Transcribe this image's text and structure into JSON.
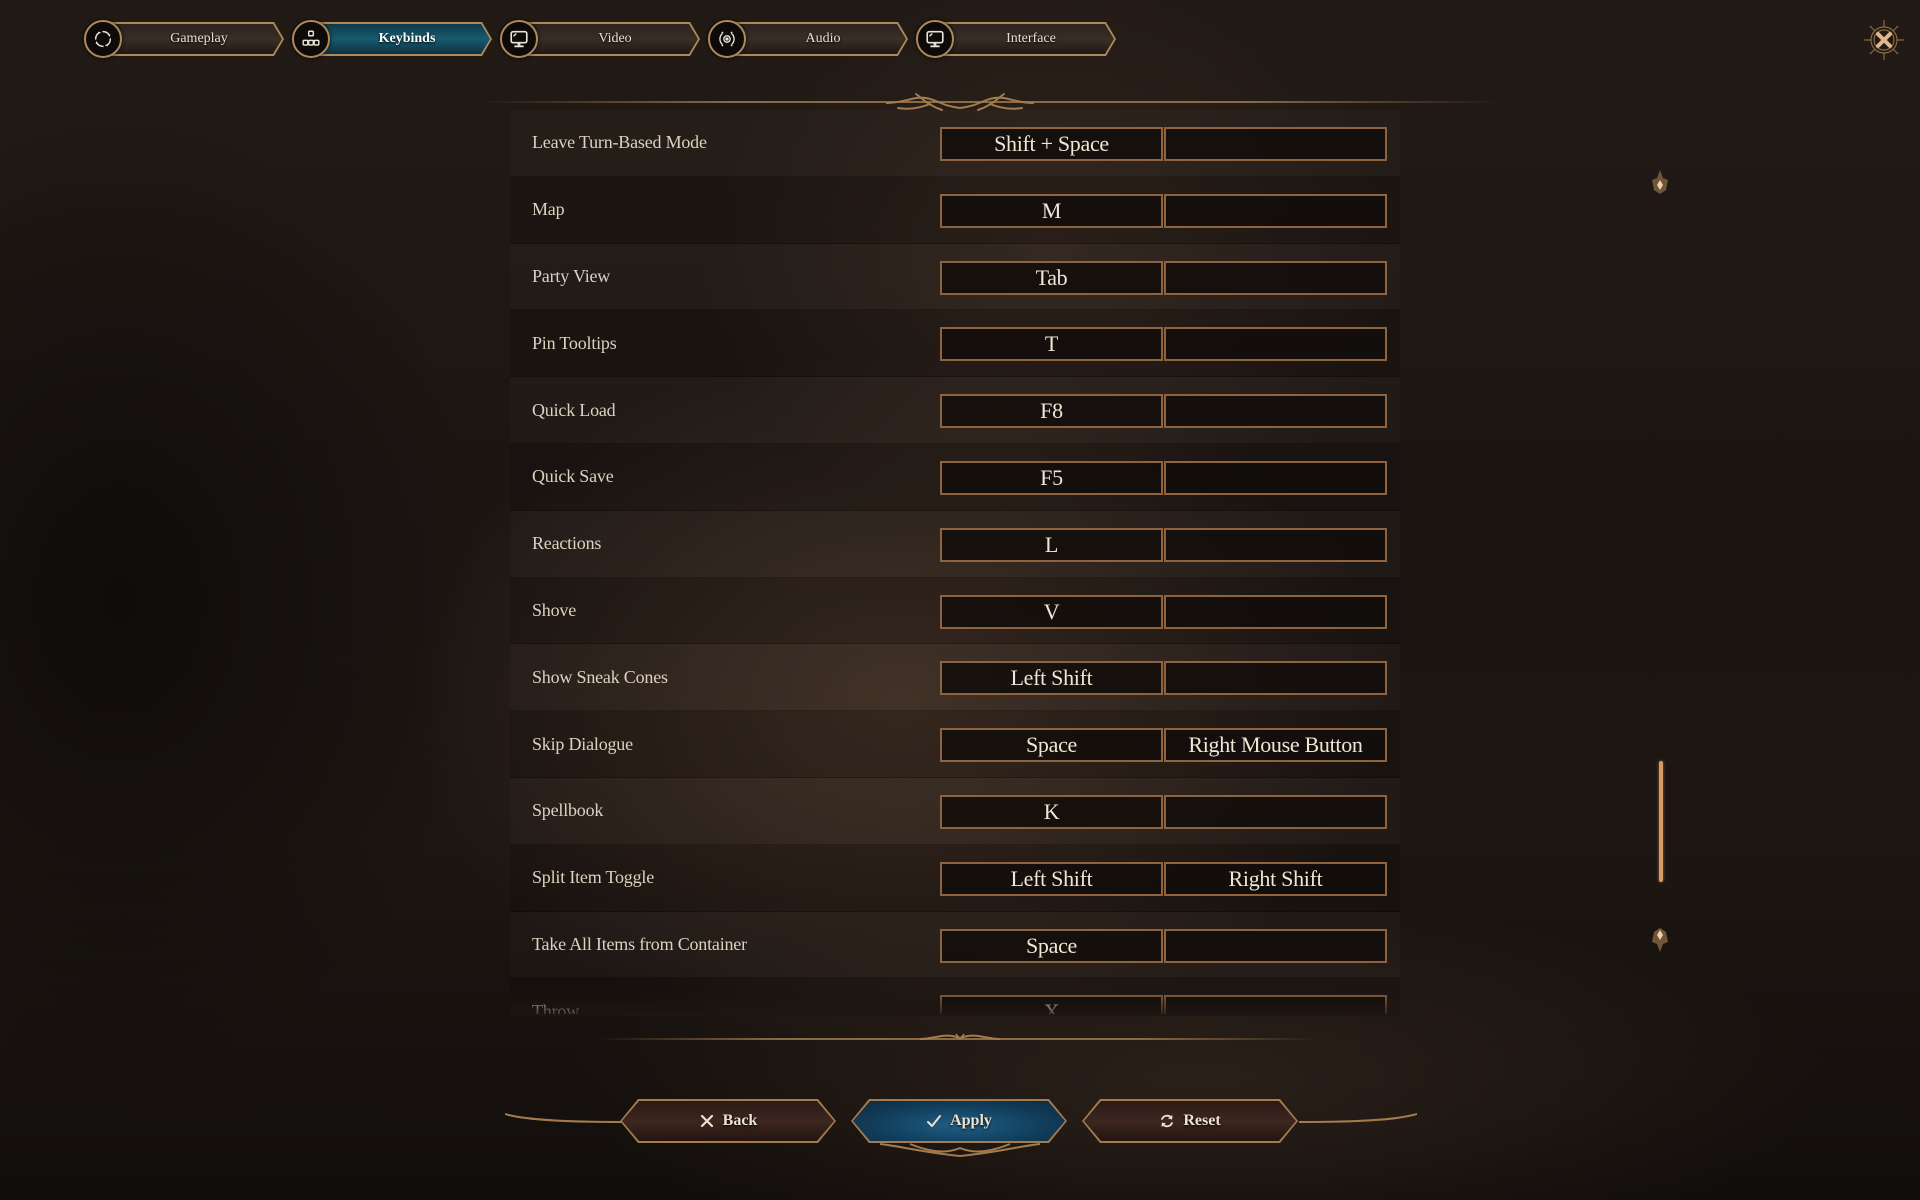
{
  "tabs": [
    {
      "label": "Gameplay",
      "icon": "gameplay-icon",
      "active": false
    },
    {
      "label": "Keybinds",
      "icon": "keybinds-icon",
      "active": true
    },
    {
      "label": "Video",
      "icon": "monitor-icon",
      "active": false
    },
    {
      "label": "Audio",
      "icon": "speaker-icon",
      "active": false
    },
    {
      "label": "Interface",
      "icon": "monitor-icon",
      "active": false
    }
  ],
  "close": {
    "icon": "close-icon"
  },
  "keybinds": [
    {
      "action": "Leave Turn-Based Mode",
      "primary": "Shift + Space",
      "secondary": ""
    },
    {
      "action": "Map",
      "primary": "M",
      "secondary": ""
    },
    {
      "action": "Party View",
      "primary": "Tab",
      "secondary": ""
    },
    {
      "action": "Pin Tooltips",
      "primary": "T",
      "secondary": ""
    },
    {
      "action": "Quick Load",
      "primary": "F8",
      "secondary": ""
    },
    {
      "action": "Quick Save",
      "primary": "F5",
      "secondary": ""
    },
    {
      "action": "Reactions",
      "primary": "L",
      "secondary": ""
    },
    {
      "action": "Shove",
      "primary": "V",
      "secondary": ""
    },
    {
      "action": "Show Sneak Cones",
      "primary": "Left Shift",
      "secondary": ""
    },
    {
      "action": "Skip Dialogue",
      "primary": "Space",
      "secondary": "Right Mouse Button"
    },
    {
      "action": "Spellbook",
      "primary": "K",
      "secondary": ""
    },
    {
      "action": "Split Item Toggle",
      "primary": "Left Shift",
      "secondary": "Right Shift"
    },
    {
      "action": "Take All Items from Container",
      "primary": "Space",
      "secondary": ""
    },
    {
      "action": "Throw",
      "primary": "X",
      "secondary": ""
    }
  ],
  "scrollbar": {
    "position_fraction": 0.78,
    "visible_fraction": 0.16
  },
  "buttons": {
    "back": {
      "label": "Back",
      "icon": "x-icon"
    },
    "apply": {
      "label": "Apply",
      "icon": "checkmark-icon"
    },
    "reset": {
      "label": "Reset",
      "icon": "reset-icon"
    }
  },
  "colors": {
    "accent_gold": "#b0895a",
    "active_tab_teal": "#185a70",
    "apply_blue": "#1f5e86",
    "bind_border": "#8f633d",
    "scroll_thumb": "#d79a62"
  }
}
